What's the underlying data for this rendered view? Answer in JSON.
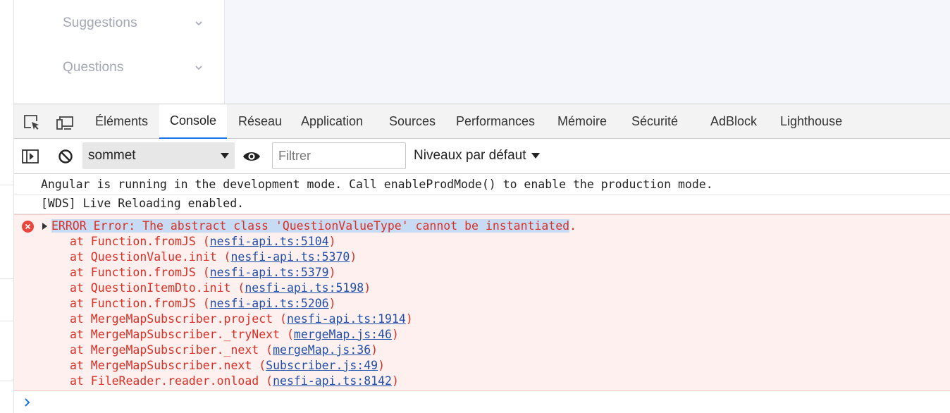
{
  "sidebar": {
    "items": [
      {
        "label": "Suggestions",
        "icon": "chevron-down-icon"
      },
      {
        "label": "Questions",
        "icon": "chevron-down-icon"
      }
    ]
  },
  "devtools": {
    "tools": [
      {
        "icon": "inspect-element-icon"
      },
      {
        "icon": "device-toolbar-icon"
      }
    ],
    "tabs": [
      {
        "label": "Éléments"
      },
      {
        "label": "Console",
        "active": true
      },
      {
        "label": "Réseau"
      },
      {
        "label": "Application"
      },
      {
        "label": "Sources"
      },
      {
        "label": "Performances"
      },
      {
        "label": "Mémoire"
      },
      {
        "label": "Sécurité"
      },
      {
        "label": "AdBlock"
      },
      {
        "label": "Lighthouse"
      }
    ]
  },
  "toolbar": {
    "sidebar_toggle_icon": "show-console-sidebar-icon",
    "clear_icon": "clear-console-icon",
    "context": "sommet",
    "live_expression_icon": "eye-icon",
    "filter_placeholder": "Filtrer",
    "levels_label": "Niveaux par défaut"
  },
  "console": {
    "logs": [
      "Angular is running in the development mode. Call enableProdMode() to enable the production mode.",
      "[WDS] Live Reloading enabled."
    ],
    "error": {
      "prefix": "ERROR Error: The abstract class 'QuestionValueType' cannot be instantiated",
      "suffix": ".",
      "stack": [
        {
          "text": "at Function.fromJS (",
          "link": "nesfi-api.ts:5104",
          "end": ")"
        },
        {
          "text": "at QuestionValue.init (",
          "link": "nesfi-api.ts:5370",
          "end": ")"
        },
        {
          "text": "at Function.fromJS (",
          "link": "nesfi-api.ts:5379",
          "end": ")"
        },
        {
          "text": "at QuestionItemDto.init (",
          "link": "nesfi-api.ts:5198",
          "end": ")"
        },
        {
          "text": "at Function.fromJS (",
          "link": "nesfi-api.ts:5206",
          "end": ")"
        },
        {
          "text": "at MergeMapSubscriber.project (",
          "link": "nesfi-api.ts:1914",
          "end": ")"
        },
        {
          "text": "at MergeMapSubscriber._tryNext (",
          "link": "mergeMap.js:46",
          "end": ")"
        },
        {
          "text": "at MergeMapSubscriber._next (",
          "link": "mergeMap.js:36",
          "end": ")"
        },
        {
          "text": "at MergeMapSubscriber.next (",
          "link": "Subscriber.js:49",
          "end": ")"
        },
        {
          "text": "at FileReader.reader.onload (",
          "link": "nesfi-api.ts:8142",
          "end": ")"
        }
      ]
    },
    "prompt_icon": "prompt-chevron-icon"
  },
  "colors": {
    "error_text": "#d93025",
    "error_bg": "#fff0f0",
    "link": "#1f4fa8",
    "active_tab_underline": "#1a73e8",
    "selection": "#c8dbf5"
  }
}
